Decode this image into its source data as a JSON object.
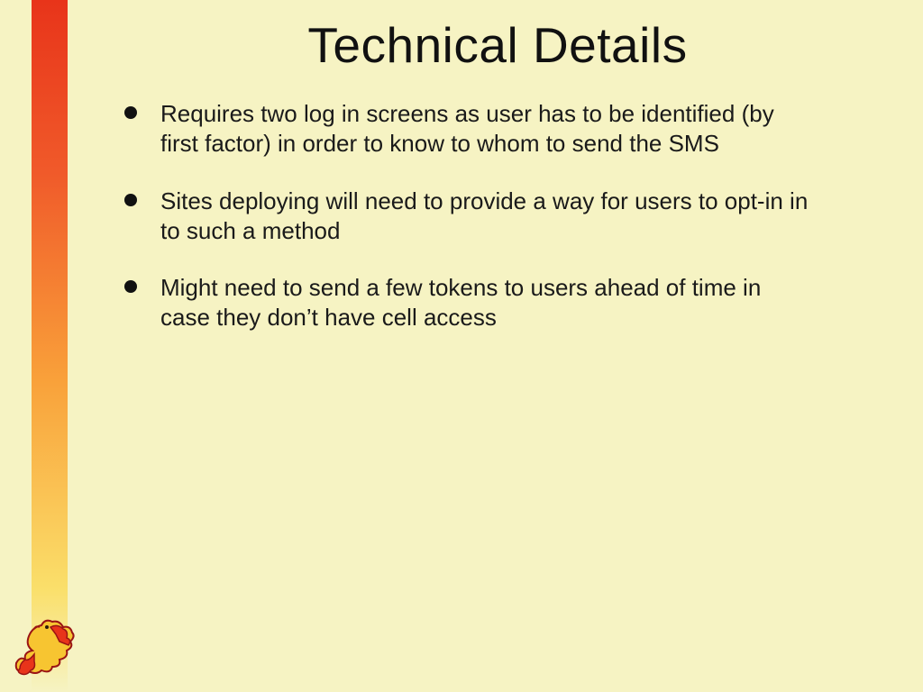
{
  "title": "Technical Details",
  "bullets": [
    "Requires two log in screens as user has to be identified (by first factor) in order to know to whom to send the SMS",
    "Sites deploying will need to provide a way for users to opt-in in to such a method",
    "Might need to send a few tokens to users ahead of time in case they don’t have cell access"
  ]
}
